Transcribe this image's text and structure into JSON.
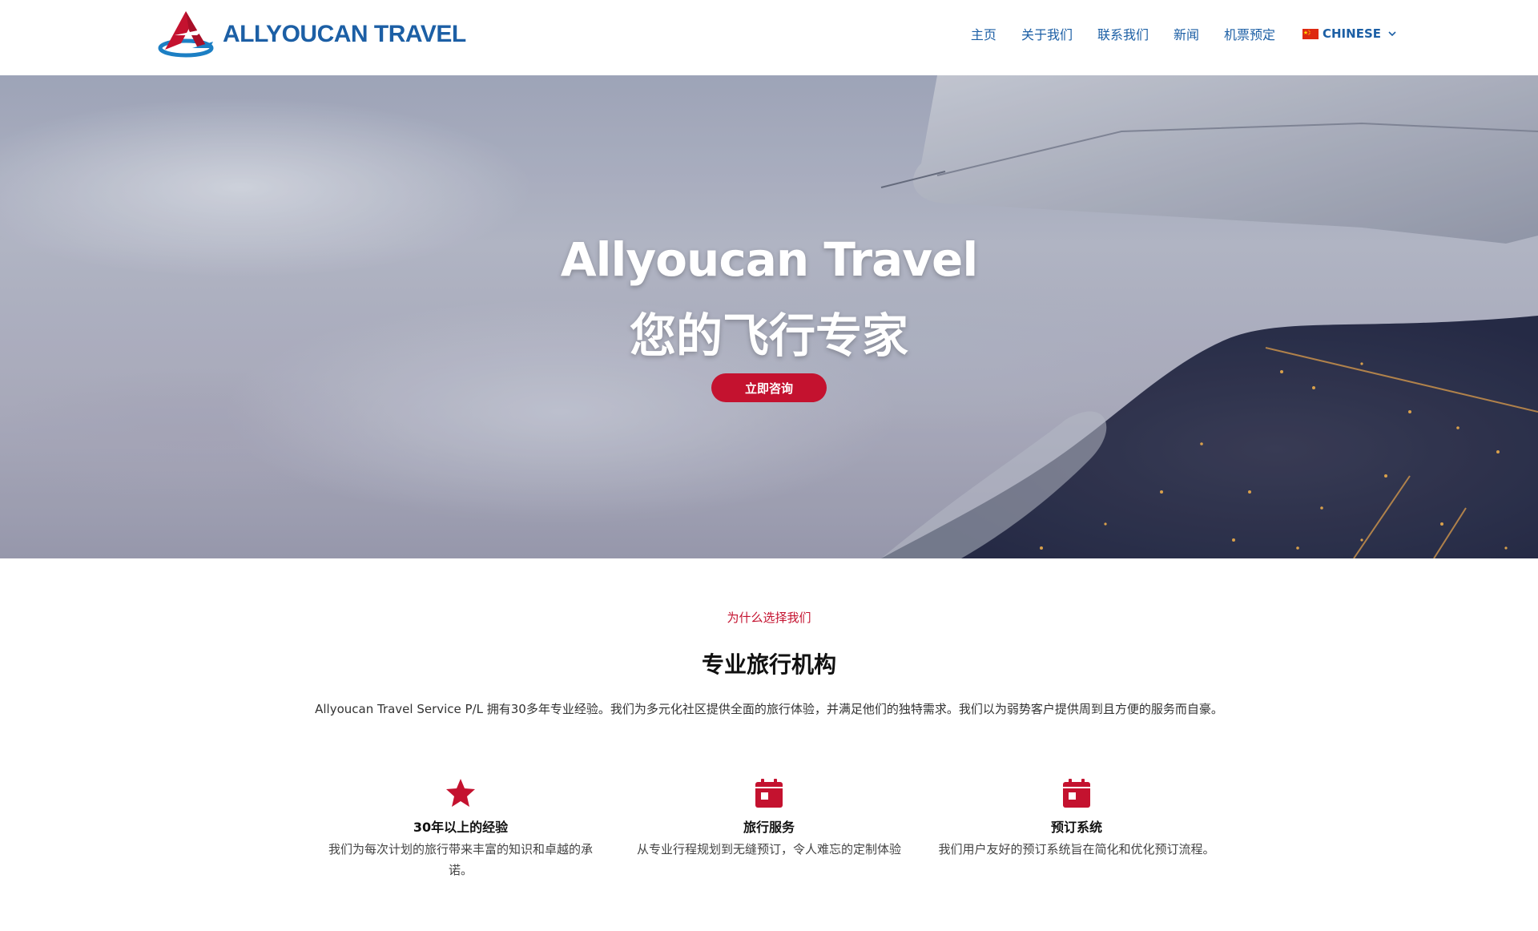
{
  "brand": {
    "name": "ALLYOUCAN TRAVEL",
    "primary_color": "#1c5fa5",
    "accent_color": "#c4122f"
  },
  "nav": {
    "items": [
      "主页",
      "关于我们",
      "联系我们",
      "新闻",
      "机票预定"
    ],
    "language": {
      "label": "CHINESE",
      "flag_icon": "china-flag-icon",
      "dropdown_icon": "chevron-down-icon"
    }
  },
  "hero": {
    "title_line1": "Allyoucan Travel",
    "title_line2": "您的飞行专家",
    "cta_label": "立即咨询"
  },
  "why": {
    "eyebrow": "为什么选择我们",
    "title": "专业旅行机构",
    "intro": "Allyoucan Travel Service P/L 拥有30多年专业经验。我们为多元化社区提供全面的旅行体验，并满足他们的独特需求。我们以为弱势客户提供周到且方便的服务而自豪。",
    "features": [
      {
        "icon": "star-icon",
        "title": "30年以上的经验",
        "desc": "我们为每次计划的旅行带来丰富的知识和卓越的承诺。"
      },
      {
        "icon": "calendar-icon",
        "title": "旅行服务",
        "desc": "从专业行程规划到无缝预订，令人难忘的定制体验"
      },
      {
        "icon": "calendar-icon",
        "title": "预订系统",
        "desc": "我们用户友好的预订系统旨在简化和优化预订流程。"
      }
    ]
  }
}
